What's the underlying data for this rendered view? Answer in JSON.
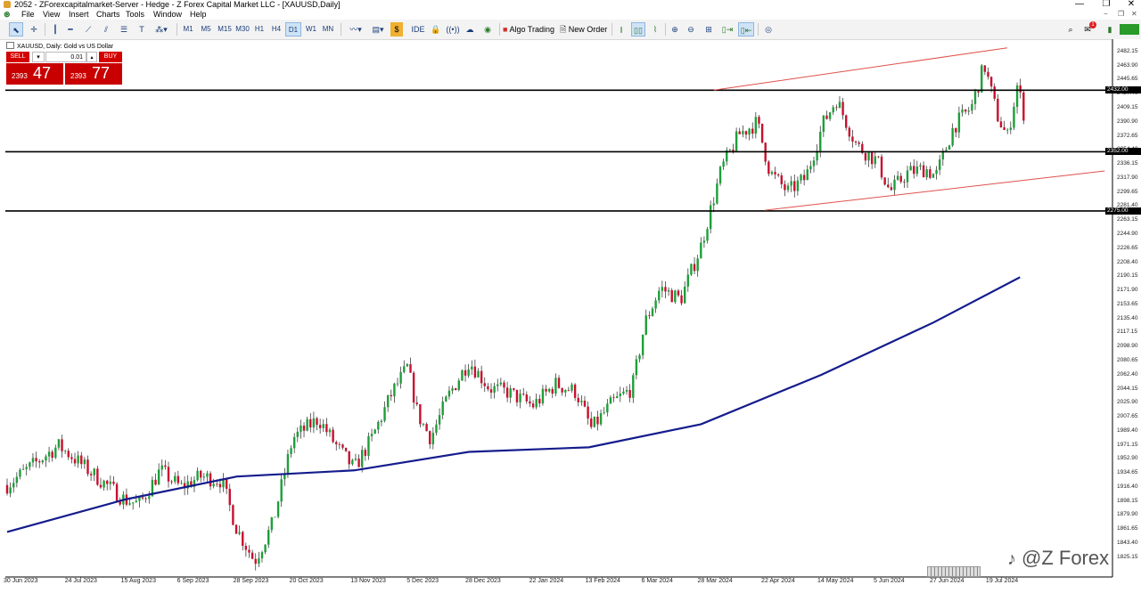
{
  "window": {
    "title": "2052 - ZForexcapitalmarket-Server - Hedge - Z Forex Capital Market LLC - [XAUUSD,Daily]",
    "min": "—",
    "max": "❐",
    "close": "✕"
  },
  "menu": {
    "items": [
      "File",
      "View",
      "Insert",
      "Charts",
      "Tools",
      "Window",
      "Help"
    ],
    "mdi_min": "−",
    "mdi_restore": "❐",
    "mdi_close": "✕"
  },
  "toolbar": {
    "timeframes": [
      "M1",
      "M5",
      "M15",
      "M30",
      "H1",
      "H4",
      "D1",
      "W1",
      "MN"
    ],
    "active_timeframe": "D1",
    "ide_label": "IDE",
    "algo_label": "Algo Trading",
    "neworder_label": "New Order",
    "notification_count": "1"
  },
  "chart_header": {
    "symbol_text": "XAUUSD, Daily:  Gold vs US Dollar"
  },
  "trade_panel": {
    "sell_label": "SELL",
    "buy_label": "BUY",
    "lot": "0.01",
    "sell_small": "2393",
    "sell_big": "47",
    "buy_small": "2393",
    "buy_big": "77"
  },
  "chart_data": {
    "type": "candlestick",
    "symbol": "XAUUSD",
    "timeframe": "Daily",
    "y_ticks": [
      "2482.15",
      "2463.90",
      "2445.65",
      "2427.40",
      "2409.15",
      "2390.90",
      "2372.65",
      "2354.40",
      "2336.15",
      "2317.90",
      "2299.65",
      "2281.40",
      "2263.15",
      "2244.90",
      "2226.65",
      "2208.40",
      "2190.15",
      "2171.90",
      "2153.65",
      "2135.40",
      "2117.15",
      "2098.90",
      "2080.65",
      "2062.40",
      "2044.15",
      "2025.90",
      "2007.65",
      "1989.40",
      "1971.15",
      "1952.90",
      "1934.65",
      "1916.40",
      "1898.15",
      "1879.90",
      "1861.65",
      "1843.40",
      "1825.15"
    ],
    "x_ticks": [
      "30 Jun 2023",
      "24 Jul 2023",
      "15 Aug 2023",
      "6 Sep 2023",
      "28 Sep 2023",
      "20 Oct 2023",
      "13 Nov 2023",
      "5 Dec 2023",
      "28 Dec 2023",
      "22 Jan 2024",
      "13 Feb 2024",
      "6 Mar 2024",
      "28 Mar 2024",
      "22 Apr 2024",
      "14 May 2024",
      "5 Jun 2024",
      "27 Jun 2024",
      "19 Jul 2024"
    ],
    "ylim": [
      1818,
      2489
    ],
    "horizontal_levels": [
      {
        "value": 2432.0,
        "label": "2432.00"
      },
      {
        "value": 2352.0,
        "label": "2352.00"
      },
      {
        "value": 2275.0,
        "label": "2275.00"
      }
    ],
    "channel_lines": [
      {
        "from": {
          "date": "2024-04-02",
          "value": 2432
        },
        "to": {
          "date": "2024-07-26",
          "value": 2487
        }
      },
      {
        "from": {
          "date": "2024-04-22",
          "value": 2276
        },
        "to": {
          "date": "2024-07-31",
          "value": 2327
        }
      }
    ],
    "ma_line": {
      "points": [
        {
          "date": "2023-06-30",
          "value": 1858
        },
        {
          "date": "2023-08-15",
          "value": 1900
        },
        {
          "date": "2023-09-28",
          "value": 1930
        },
        {
          "date": "2023-11-13",
          "value": 1938
        },
        {
          "date": "2023-12-28",
          "value": 1962
        },
        {
          "date": "2024-02-13",
          "value": 1968
        },
        {
          "date": "2024-03-28",
          "value": 1998
        },
        {
          "date": "2024-05-14",
          "value": 2062
        },
        {
          "date": "2024-06-27",
          "value": 2130
        },
        {
          "date": "2024-07-31",
          "value": 2189
        }
      ]
    },
    "price_path": [
      {
        "date": "2023-06-30",
        "value": 1919
      },
      {
        "date": "2023-07-20",
        "value": 1970
      },
      {
        "date": "2023-07-24",
        "value": 1960
      },
      {
        "date": "2023-08-02",
        "value": 1935
      },
      {
        "date": "2023-08-15",
        "value": 1900
      },
      {
        "date": "2023-08-21",
        "value": 1894
      },
      {
        "date": "2023-08-29",
        "value": 1938
      },
      {
        "date": "2023-09-06",
        "value": 1916
      },
      {
        "date": "2023-09-14",
        "value": 1930
      },
      {
        "date": "2023-09-22",
        "value": 1925
      },
      {
        "date": "2023-09-28",
        "value": 1862
      },
      {
        "date": "2023-10-05",
        "value": 1820
      },
      {
        "date": "2023-10-12",
        "value": 1868
      },
      {
        "date": "2023-10-20",
        "value": 1980
      },
      {
        "date": "2023-10-30",
        "value": 2005
      },
      {
        "date": "2023-11-06",
        "value": 1970
      },
      {
        "date": "2023-11-13",
        "value": 1940
      },
      {
        "date": "2023-11-20",
        "value": 1980
      },
      {
        "date": "2023-11-28",
        "value": 2040
      },
      {
        "date": "2023-12-04",
        "value": 2072
      },
      {
        "date": "2023-12-08",
        "value": 2010
      },
      {
        "date": "2023-12-13",
        "value": 1980
      },
      {
        "date": "2023-12-20",
        "value": 2035
      },
      {
        "date": "2023-12-28",
        "value": 2080
      },
      {
        "date": "2024-01-05",
        "value": 2045
      },
      {
        "date": "2024-01-12",
        "value": 2040
      },
      {
        "date": "2024-01-22",
        "value": 2022
      },
      {
        "date": "2024-01-31",
        "value": 2050
      },
      {
        "date": "2024-02-08",
        "value": 2040
      },
      {
        "date": "2024-02-14",
        "value": 1992
      },
      {
        "date": "2024-02-22",
        "value": 2025
      },
      {
        "date": "2024-03-01",
        "value": 2045
      },
      {
        "date": "2024-03-06",
        "value": 2130
      },
      {
        "date": "2024-03-12",
        "value": 2175
      },
      {
        "date": "2024-03-20",
        "value": 2160
      },
      {
        "date": "2024-03-28",
        "value": 2230
      },
      {
        "date": "2024-04-05",
        "value": 2330
      },
      {
        "date": "2024-04-12",
        "value": 2375
      },
      {
        "date": "2024-04-19",
        "value": 2390
      },
      {
        "date": "2024-04-24",
        "value": 2325
      },
      {
        "date": "2024-05-01",
        "value": 2300
      },
      {
        "date": "2024-05-08",
        "value": 2318
      },
      {
        "date": "2024-05-15",
        "value": 2390
      },
      {
        "date": "2024-05-20",
        "value": 2420
      },
      {
        "date": "2024-05-28",
        "value": 2360
      },
      {
        "date": "2024-06-05",
        "value": 2340
      },
      {
        "date": "2024-06-10",
        "value": 2300
      },
      {
        "date": "2024-06-17",
        "value": 2325
      },
      {
        "date": "2024-06-24",
        "value": 2330
      },
      {
        "date": "2024-06-28",
        "value": 2320
      },
      {
        "date": "2024-07-05",
        "value": 2385
      },
      {
        "date": "2024-07-12",
        "value": 2410
      },
      {
        "date": "2024-07-17",
        "value": 2465
      },
      {
        "date": "2024-07-22",
        "value": 2400
      },
      {
        "date": "2024-07-26",
        "value": 2370
      },
      {
        "date": "2024-07-30",
        "value": 2440
      },
      {
        "date": "2024-08-02",
        "value": 2393
      }
    ],
    "colors": {
      "bull": "#1e9e3a",
      "bear": "#c8102e",
      "ma": "#141c8c",
      "channel": "#e0504a",
      "levels": "#000000"
    }
  },
  "watermark": {
    "text": "@Z Forex"
  }
}
